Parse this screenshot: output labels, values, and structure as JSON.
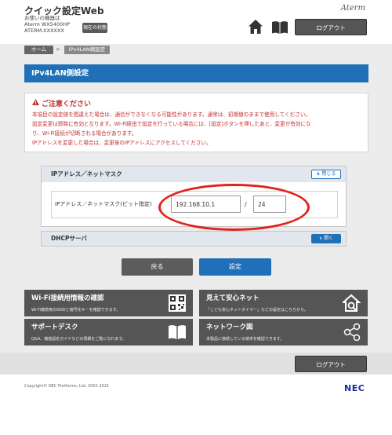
{
  "header": {
    "brand": "クイック設定Web",
    "device_caption": "お使いの機器は",
    "device_model": "Aterm  WX5400HP",
    "device_name": "ATERM-XXXXXX",
    "status_button": "現在の状態",
    "logo": "Aterm",
    "logout_label": "ログアウト"
  },
  "breadcrumb": {
    "home": "ホーム",
    "separator": ">",
    "current": "IPv4LAN側設定"
  },
  "page": {
    "title": "IPv4LAN側設定"
  },
  "caution": {
    "heading": "ご注意ください",
    "lines": [
      "本項目の設定値を間違えた場合は、通信ができなくなる可能性があります。通常は、初期値のままで使用してください。",
      "設定変更は即時に有効となります。Wi-Fi経由で設定を行っている場合には、[設定]ボタンを押したあと、変更が有効にな",
      "り、Wi-Fi接続が切断される場合があります。",
      "IPアドレスを変更した場合は、変更後のIPアドレスにアクセスしてください。"
    ]
  },
  "ip_section": {
    "title": "IPアドレス／ネットマスク",
    "toggle_label": "閉じる",
    "row_label": "IPアドレス／ネットマスク(ビット指定)",
    "ip_value": "192.168.10.1",
    "slash": "/",
    "mask_value": "24"
  },
  "dhcp_section": {
    "title": "DHCPサーバ",
    "toggle_label": "開く"
  },
  "actions": {
    "back": "戻る",
    "set": "設定"
  },
  "tiles": [
    {
      "title": "Wi-Fi接続用情報の確認",
      "desc": "Wi-Fi接続用のSSIDと暗号化キーを確認できます。",
      "icon": "qr-code-icon"
    },
    {
      "title": "見えて安心ネット",
      "desc": "「こども安心ネットタイマー」などの設定はこちらから。",
      "icon": "house-search-icon"
    },
    {
      "title": "サポートデスク",
      "desc": "Q&A、機能設定ガイドなどの情報をご覧になれます。",
      "icon": "book-icon"
    },
    {
      "title": "ネットワーク図",
      "desc": "本製品に接続している端末を確認できます。",
      "icon": "share-network-icon"
    }
  ],
  "footer": {
    "logout_label": "ログアウト",
    "copyright": "Copyright© NEC Platforms, Ltd. 2001-2021",
    "company_logo": "NEC"
  },
  "colors": {
    "accent_blue": "#1f70b8",
    "caution_red": "#c03030",
    "highlight_red": "#e2231a",
    "dark_button": "#555555"
  }
}
